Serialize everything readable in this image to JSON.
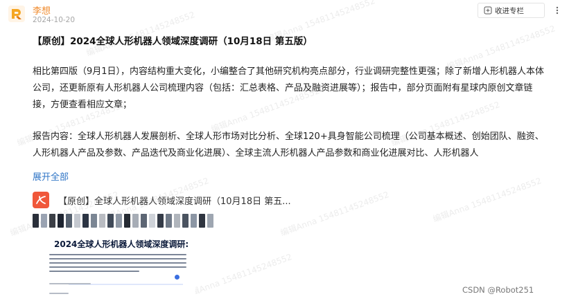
{
  "post": {
    "author": "李想",
    "date": "2024-10-20",
    "title": "【原创】2024全球人形机器人领域深度调研（10月18日 第五版）",
    "paragraphs": [
      "相比第四版（9月1日），内容结构重大变化，小编整合了其他研究机构亮点部分，行业调研完整性更强；除了新增人形机器人本体公司，还更新原有人形机器人公司梳理内容（包括：汇总表格、产品及融资进展等）；报告中，部分页面附有星球内原创文章链接，方便查看相应文章；",
      "报告内容：全球人形机器人发展剖析、全球人形市场对比分析、全球120+具身智能公司梳理（公司基本概述、创始团队、融资、人形机器人产品及参数、产品迭代及商业化进展）、全球主流人形机器人产品参数和商业化进展对比、人形机器人"
    ],
    "expand_label": "展开全部"
  },
  "actions": {
    "favorite_label": "收进专栏"
  },
  "attachment": {
    "name": "【原创】全球人形机器人领域深度调研（10月18日 第五...",
    "icon": "pdf-file-icon",
    "cover_title": "2024全球人形机器人领域深度调研:"
  },
  "watermark": "编辑Anna 15481145248552",
  "footer": "CSDN @Robot251",
  "colors": {
    "accent": "#f08b2e",
    "link": "#2e74c6",
    "pdf_red": "#f0573a"
  }
}
